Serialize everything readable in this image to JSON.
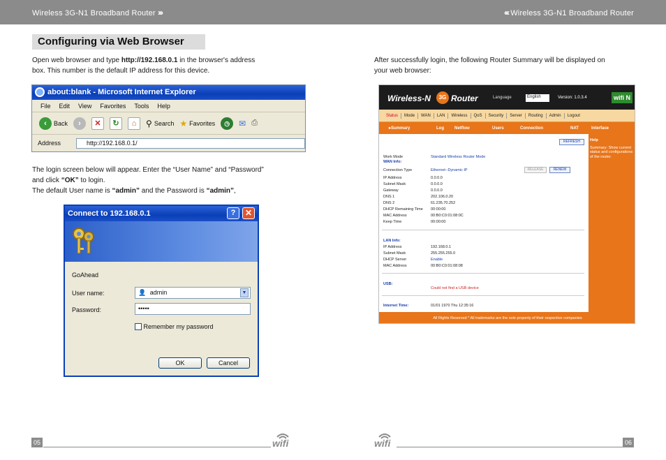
{
  "header": {
    "left_title": "Wireless 3G-N1 Broadband Router",
    "right_title": "Wireless 3G-N1 Broadband Router",
    "left_chevrons": "›››",
    "right_chevrons": "‹‹‹"
  },
  "left": {
    "section_title": "Configuring via Web Browser",
    "intro_line1_pre": "Open web browser and type ",
    "intro_line1_bold": "http://192.168.0.1",
    "intro_line1_post": " in the browser's address",
    "intro_line2": "box. This number is the default IP address for this device.",
    "login_line1": "The login screen below will appear. Enter the “User Name” and “Password”",
    "login_line2_pre": "and click ",
    "login_line2_bold": "“OK”",
    "login_line2_post": " to login.",
    "login_line3_pre": "The default User name is ",
    "login_line3_bold1": "“admin”",
    "login_line3_mid": " and the Password is ",
    "login_line3_bold2": "“admin”",
    "login_line3_post": ",",
    "page_number": "05"
  },
  "ie_window": {
    "title": "about:blank - Microsoft Internet Explorer",
    "menu": [
      "File",
      "Edit",
      "View",
      "Favorites",
      "Tools",
      "Help"
    ],
    "back_label": "Back",
    "search_label": "Search",
    "favorites_label": "Favorites",
    "address_label": "Address",
    "address_value": "http://192.168.0.1/"
  },
  "login_dialog": {
    "title": "Connect to 192.168.0.1",
    "help_glyph": "?",
    "close_glyph": "✕",
    "realm": "GoAhead",
    "username_label": "User name:",
    "username_value": "admin",
    "password_label": "Password:",
    "password_value": "•••••",
    "remember_label": "Remember my password",
    "ok_label": "OK",
    "cancel_label": "Cancel"
  },
  "right": {
    "intro_line1": "After successfully login, the following Router Summary will be displayed on",
    "intro_line2": "your web browser:",
    "page_number": "06"
  },
  "router_ui": {
    "brand": "Wireless-N",
    "badge_3g": "3G",
    "brand_router": "Router",
    "language_label": "Language",
    "language_value": "English",
    "version": "Version: 1.0.3.4",
    "wifi_badge": "wifi N",
    "nav": [
      "Status",
      "Mode",
      "WAN",
      "LAN",
      "Wireless",
      "QoS",
      "Security",
      "Server",
      "Routing",
      "Admin",
      "Logout"
    ],
    "sub_nav": [
      "▸Summary",
      "Log",
      "Netflow",
      "Users",
      "Connection",
      "NAT",
      "Interface"
    ],
    "refresh_label": "REFRESH",
    "release_label": "RELEASE",
    "renew_label": "RENEW",
    "work_mode_key": "Work Mode",
    "work_mode_value": "Standard Wireless Router Mode",
    "wan_header": "WAN Info:",
    "wan_rows": [
      {
        "key": "Connection Type",
        "value": "Ethernet--Dynamic IP"
      },
      {
        "key": "IP Address",
        "value": "0.0.0.0"
      },
      {
        "key": "Subnet Mask",
        "value": "0.0.0.0"
      },
      {
        "key": "Gateway",
        "value": "0.0.0.0"
      },
      {
        "key": "DNS 1",
        "value": "202.106.0.20"
      },
      {
        "key": "DNS 2",
        "value": "61.235.70.252"
      },
      {
        "key": "DHCP Remaining Time",
        "value": "00:00:00"
      },
      {
        "key": "MAC Address",
        "value": "00:B0:C0:01:08:0C"
      },
      {
        "key": "Keep Time",
        "value": "00:00:00"
      }
    ],
    "lan_header": "LAN Info:",
    "lan_rows": [
      {
        "key": "IP Address",
        "value": "192.168.0.1"
      },
      {
        "key": "Subnet Mask",
        "value": "255.255.255.0"
      },
      {
        "key": "DHCP Server",
        "value": "Enable"
      },
      {
        "key": "MAC Address",
        "value": "00:B0:C0:01:08:08"
      }
    ],
    "usb_header": "USB:",
    "usb_value": "Could not find a USB device",
    "time_header": "Internet Time:",
    "time_value": "01/01 1970 Thu 12:35:16",
    "help_title": "Help",
    "help_text": "Summary: Show current status and configurations of the router.",
    "footer": "All Rights Reserved * All trademarks are the sole property of their respective companies"
  },
  "footer": {
    "wifi_logo": "wifi"
  },
  "colors": {
    "bar_gray": "#8b8b8b",
    "router_orange": "#e8751a",
    "xp_blue": "#0a3fb7"
  }
}
